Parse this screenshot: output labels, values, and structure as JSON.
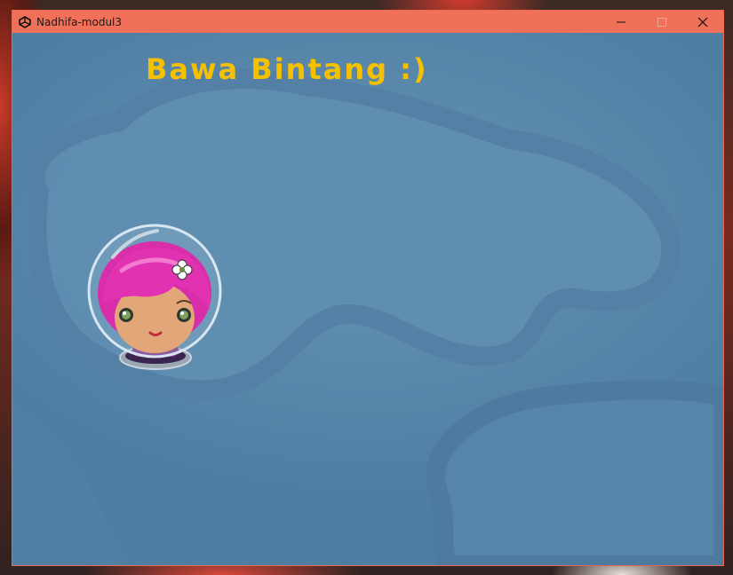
{
  "window": {
    "title": "Nadhifa-modul3",
    "controls": {
      "minimize": "minimize-icon",
      "maximize": "maximize-icon",
      "close": "close-icon"
    }
  },
  "game": {
    "heading": "Bawa Bintang :)",
    "colors": {
      "heading": "#f5c000",
      "background": "#5a88ab",
      "titlebar": "#f0705a"
    }
  }
}
